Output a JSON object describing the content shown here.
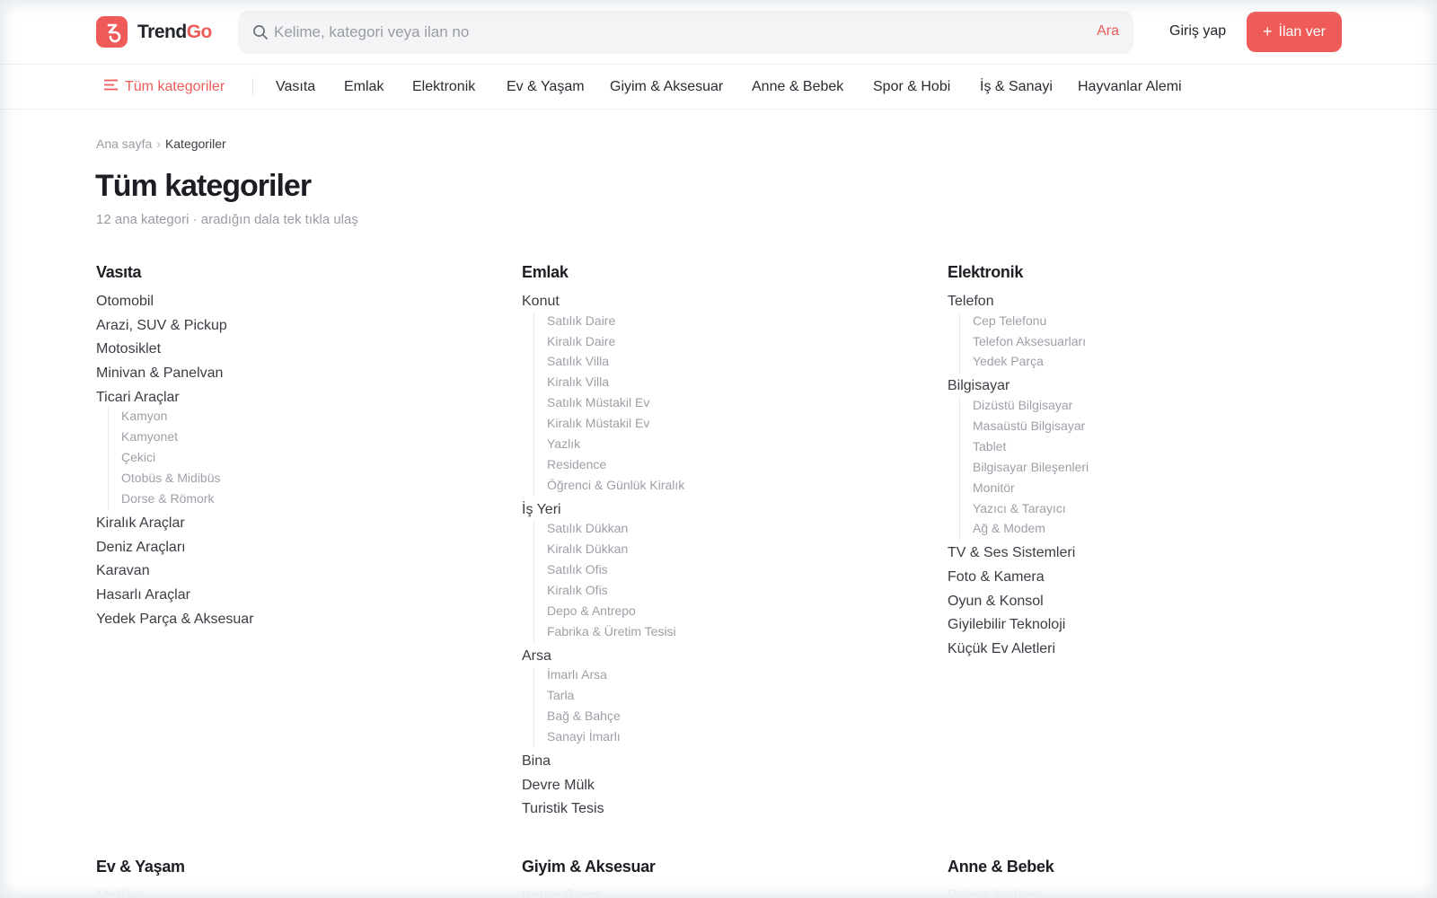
{
  "header": {
    "logo_text_a": "Trend",
    "logo_text_b": "Go",
    "search_placeholder": "Kelime, kategori veya ilan no",
    "search_button": "Ara",
    "login": "Giriş yap",
    "post_ad": "İlan ver"
  },
  "nav": {
    "all": "Tüm kategoriler",
    "items": [
      "Vasıta",
      "Emlak",
      "Elektronik",
      "Ev & Yaşam",
      "Giyim & Aksesuar",
      "Anne & Bebek",
      "Spor & Hobi",
      "İş & Sanayi",
      "Hayvanlar Alemi"
    ]
  },
  "breadcrumb": {
    "home": "Ana sayfa",
    "separator": "›",
    "current": "Kategoriler"
  },
  "page": {
    "title": "Tüm kategoriler",
    "subtitle": "12 ana kategori · aradığın dala tek tıkla ulaş"
  },
  "categories": [
    {
      "title": "Vasıta",
      "groups": [
        {
          "name": "Otomobil",
          "leaves": []
        },
        {
          "name": "Arazi, SUV & Pickup",
          "leaves": []
        },
        {
          "name": "Motosiklet",
          "leaves": []
        },
        {
          "name": "Minivan & Panelvan",
          "leaves": []
        },
        {
          "name": "Ticari Araçlar",
          "leaves": [
            "Kamyon",
            "Kamyonet",
            "Çekici",
            "Otobüs & Midibüs",
            "Dorse & Römork"
          ]
        },
        {
          "name": "Kiralık Araçlar",
          "leaves": []
        },
        {
          "name": "Deniz Araçları",
          "leaves": []
        },
        {
          "name": "Karavan",
          "leaves": []
        },
        {
          "name": "Hasarlı Araçlar",
          "leaves": []
        },
        {
          "name": "Yedek Parça & Aksesuar",
          "leaves": []
        }
      ]
    },
    {
      "title": "Emlak",
      "groups": [
        {
          "name": "Konut",
          "leaves": [
            "Satılık Daire",
            "Kiralık Daire",
            "Satılık Villa",
            "Kiralık Villa",
            "Satılık Müstakil Ev",
            "Kiralık Müstakil Ev",
            "Yazlık",
            "Residence",
            "Öğrenci & Günlük Kiralık"
          ]
        },
        {
          "name": "İş Yeri",
          "leaves": [
            "Satılık Dükkan",
            "Kiralık Dükkan",
            "Satılık Ofis",
            "Kiralık Ofis",
            "Depo & Antrepo",
            "Fabrika & Üretim Tesisi"
          ]
        },
        {
          "name": "Arsa",
          "leaves": [
            "İmarlı Arsa",
            "Tarla",
            "Bağ & Bahçe",
            "Sanayi İmarlı"
          ]
        },
        {
          "name": "Bina",
          "leaves": []
        },
        {
          "name": "Devre Mülk",
          "leaves": []
        },
        {
          "name": "Turistik Tesis",
          "leaves": []
        }
      ]
    },
    {
      "title": "Elektronik",
      "groups": [
        {
          "name": "Telefon",
          "leaves": [
            "Cep Telefonu",
            "Telefon Aksesuarları",
            "Yedek Parça"
          ]
        },
        {
          "name": "Bilgisayar",
          "leaves": [
            "Dizüstü Bilgisayar",
            "Masaüstü Bilgisayar",
            "Tablet",
            "Bilgisayar Bileşenleri",
            "Monitör",
            "Yazıcı & Tarayıcı",
            "Ağ & Modem"
          ]
        },
        {
          "name": "TV & Ses Sistemleri",
          "leaves": []
        },
        {
          "name": "Foto & Kamera",
          "leaves": []
        },
        {
          "name": "Oyun & Konsol",
          "leaves": []
        },
        {
          "name": "Giyilebilir Teknoloji",
          "leaves": []
        },
        {
          "name": "Küçük Ev Aletleri",
          "leaves": []
        }
      ]
    },
    {
      "title": "Ev & Yaşam",
      "groups": [
        {
          "name": "Mobilya",
          "leaves": []
        }
      ]
    },
    {
      "title": "Giyim & Aksesuar",
      "groups": [
        {
          "name": "Kadın Giyim",
          "leaves": []
        }
      ]
    },
    {
      "title": "Anne & Bebek",
      "groups": [
        {
          "name": "Bebek Arabası",
          "leaves": []
        }
      ]
    }
  ],
  "colors": {
    "accent": "#ee5b59",
    "text": "#2a2c33",
    "muted": "#9a9ca4"
  }
}
